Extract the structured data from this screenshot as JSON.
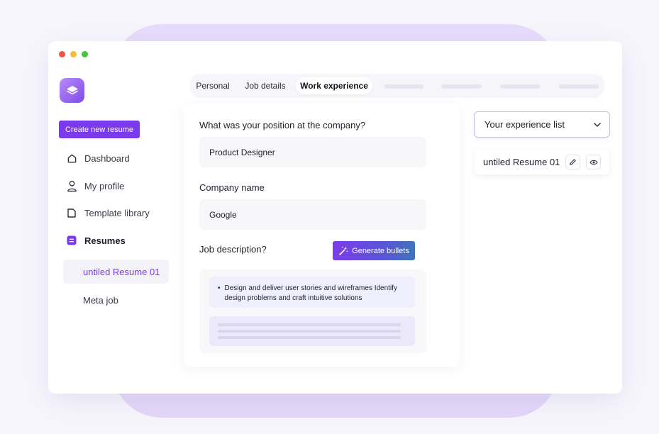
{
  "sidebar": {
    "create_label": "Create new resume",
    "items": [
      {
        "label": "Dashboard",
        "icon": "home-icon"
      },
      {
        "label": "My profile",
        "icon": "user-icon"
      },
      {
        "label": "Template library",
        "icon": "document-icon"
      },
      {
        "label": "Resumes",
        "icon": "resumes-icon"
      }
    ],
    "resumes": [
      {
        "label": "untiled Resume 01",
        "active": true
      },
      {
        "label": "Meta job",
        "active": false
      }
    ]
  },
  "tabs": [
    {
      "label": "Personal"
    },
    {
      "label": "Job details"
    },
    {
      "label": "Work experience",
      "active": true
    }
  ],
  "form": {
    "position_label": "What was your position at the company?",
    "position_value": "Product Designer",
    "company_label": "Company name",
    "company_value": "Google",
    "description_label": "Job description?",
    "generate_label": "Generate bullets",
    "bullet_text": "Design and deliver user stories and wireframes Identify design problems and craft intuitive solutions"
  },
  "experience": {
    "select_label": "Your experience list",
    "item_label": "untiled Resume 01"
  },
  "colors": {
    "accent": "#7c3aed",
    "close_dot": "#f0524a",
    "minimize_dot": "#f7bb2f",
    "maximize_dot": "#43c63c"
  }
}
